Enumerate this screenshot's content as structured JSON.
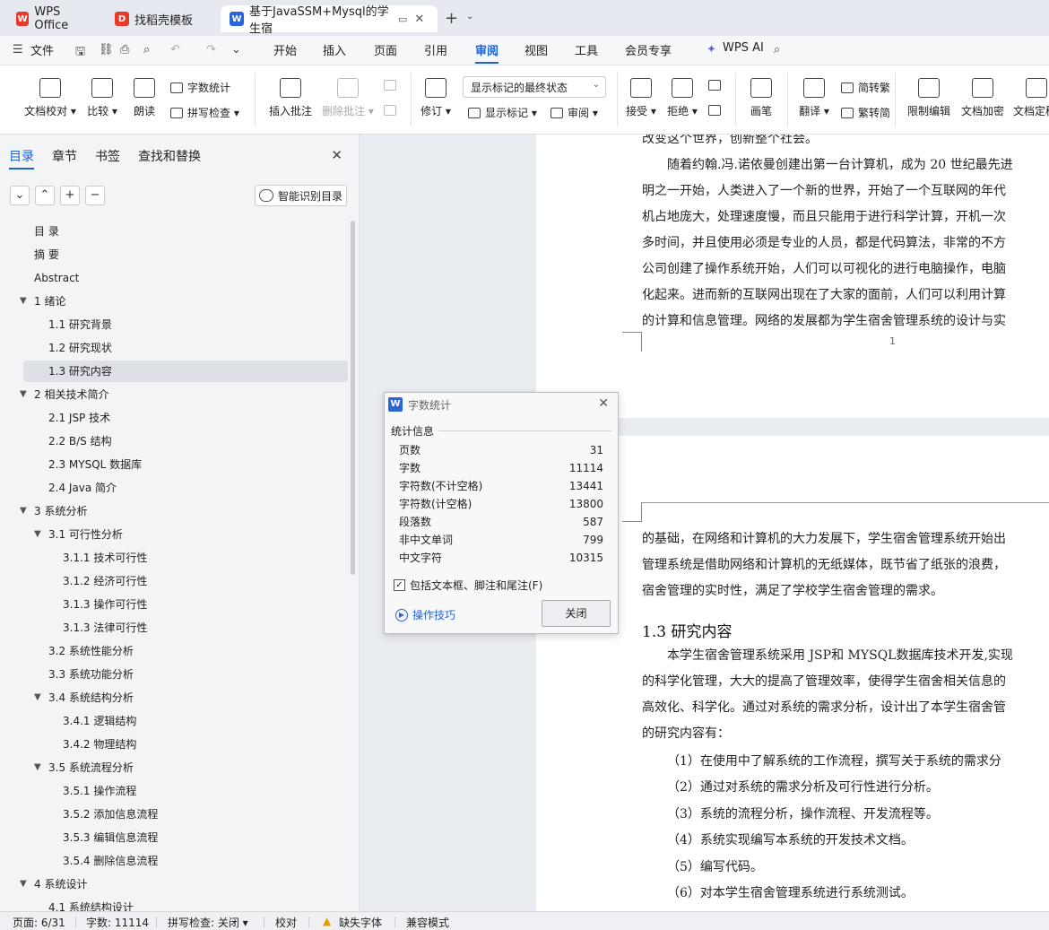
{
  "tabs": [
    {
      "label": "WPS Office",
      "icon": "wps-logo-icon",
      "color": "#e8392b"
    },
    {
      "label": "找稻壳模板",
      "icon": "docer-icon",
      "color": "#e8392b"
    },
    {
      "label": "基于JavaSSM+Mysql的学生宿",
      "icon": "writer-icon",
      "color": "#2b63d9"
    }
  ],
  "menu": {
    "file": "文件",
    "items": [
      "开始",
      "插入",
      "页面",
      "引用",
      "审阅",
      "视图",
      "工具",
      "会员专享"
    ],
    "active": "审阅",
    "wps_ai": "WPS AI"
  },
  "ribbon": {
    "doc_check": "文档校对",
    "compare": "比较",
    "read_aloud": "朗读",
    "word_count": "字数统计",
    "spell_check": "拼写检查",
    "insert_comment": "插入批注",
    "delete_comment": "删除批注",
    "revise": "修订",
    "show_mode": "显示标记的最终状态",
    "show_marks": "显示标记",
    "review_pane": "审阅",
    "accept": "接受",
    "reject": "拒绝",
    "pen": "画笔",
    "translate": "翻译",
    "to_traditional": "简转繁",
    "to_simplified": "繁转简",
    "restrict_edit": "限制编辑",
    "doc_encrypt": "文档加密",
    "doc_finalize": "文档定稿"
  },
  "sidebar": {
    "tabs": [
      "目录",
      "章节",
      "书签",
      "查找和替换"
    ],
    "smart_toc": "智能识别目录",
    "toc": [
      {
        "label": "目  录",
        "level": 1
      },
      {
        "label": "摘    要",
        "level": 1
      },
      {
        "label": "Abstract",
        "level": 1
      },
      {
        "label": "1  绪论",
        "level": 1,
        "toggle": "▼"
      },
      {
        "label": "1.1 研究背景",
        "level": 2
      },
      {
        "label": "1.2 研究现状",
        "level": 2
      },
      {
        "label": "1.3 研究内容",
        "level": 2,
        "highlight": true
      },
      {
        "label": "2  相关技术简介",
        "level": 1,
        "toggle": "▼"
      },
      {
        "label": "2.1 JSP 技术",
        "level": 2
      },
      {
        "label": "2.2 B/S 结构",
        "level": 2
      },
      {
        "label": "2.3 MYSQL 数据库",
        "level": 2
      },
      {
        "label": "2.4 Java 简介",
        "level": 2
      },
      {
        "label": "3   系统分析",
        "level": 1,
        "toggle": "▼"
      },
      {
        "label": "3.1  可行性分析",
        "level": 2,
        "toggle": "▼"
      },
      {
        "label": "3.1.1  技术可行性",
        "level": 3
      },
      {
        "label": "3.1.2  经济可行性",
        "level": 3
      },
      {
        "label": "3.1.3  操作可行性",
        "level": 3
      },
      {
        "label": "3.1.3  法律可行性",
        "level": 3
      },
      {
        "label": "3.2  系统性能分析",
        "level": 2
      },
      {
        "label": "3.3  系统功能分析",
        "level": 2
      },
      {
        "label": "3.4  系统结构分析",
        "level": 2,
        "toggle": "▼"
      },
      {
        "label": "3.4.1  逻辑结构",
        "level": 3
      },
      {
        "label": "3.4.2  物理结构",
        "level": 3
      },
      {
        "label": "3.5  系统流程分析",
        "level": 2,
        "toggle": "▼"
      },
      {
        "label": "3.5.1  操作流程",
        "level": 3
      },
      {
        "label": "3.5.2  添加信息流程",
        "level": 3
      },
      {
        "label": "3.5.3  编辑信息流程",
        "level": 3
      },
      {
        "label": "3.5.4  删除信息流程",
        "level": 3
      },
      {
        "label": "4  系统设计",
        "level": 1,
        "toggle": "▼"
      },
      {
        "label": "4.1  系统结构设计",
        "level": 2
      }
    ]
  },
  "document": {
    "page1_lines": [
      "改变这个世界，创新整个社会。",
      "随着约翰.冯.诺依曼创建出第一台计算机，成为 20 世纪最先进",
      "明之一开始，人类进入了一个新的世界，开始了一个互联网的年代",
      "机占地庞大，处理速度慢，而且只能用于进行科学计算，开机一次",
      "多时间，并且使用必须是专业的人员，都是代码算法，非常的不方",
      "公司创建了操作系统开始，人们可以可视化的进行电脑操作，电脑",
      "化起来。进而新的互联网出现在了大家的面前，人们可以利用计算",
      "的计算和信息管理。网络的发展都为学生宿舍管理系统的设计与实"
    ],
    "page_number": "1",
    "page2_lines": [
      "的基础，在网络和计算机的大力发展下，学生宿舍管理系统开始出",
      "管理系统是借助网络和计算机的无纸媒体，既节省了纸张的浪费，",
      "宿舍管理的实时性，满足了学校学生宿舍管理的需求。"
    ],
    "heading": "1.3 研究内容",
    "page2_body": [
      "本学生宿舍管理系统采用 JSP和 MYSQL数据库技术开发,实现",
      "的科学化管理，大大的提高了管理效率，使得学生宿舍相关信息的",
      "高效化、科学化。通过对系统的需求分析，设计出了本学生宿舍管",
      "的研究内容有："
    ],
    "list_items": [
      "（1）在使用中了解系统的工作流程，撰写关于系统的需求分",
      "（2）通过对系统的需求分析及可行性进行分析。",
      "（3）系统的流程分析，操作流程、开发流程等。",
      "（4）系统实现编写本系统的开发技术文档。",
      "（5）编写代码。",
      "（6）对本学生宿舍管理系统进行系统测试。"
    ]
  },
  "dialog": {
    "title": "字数统计",
    "group": "统计信息",
    "stats": [
      {
        "label": "页数",
        "value": "31"
      },
      {
        "label": "字数",
        "value": "11114"
      },
      {
        "label": "字符数(不计空格)",
        "value": "13441"
      },
      {
        "label": "字符数(计空格)",
        "value": "13800"
      },
      {
        "label": "段落数",
        "value": "587"
      },
      {
        "label": "非中文单词",
        "value": "799"
      },
      {
        "label": "中文字符",
        "value": "10315"
      }
    ],
    "checkbox_label": "包括文本框、脚注和尾注(F)",
    "checkbox_checked": true,
    "tips": "操作技巧",
    "close": "关闭"
  },
  "status": {
    "page": "页面: 6/31",
    "words": "字数: 11114",
    "spell": "拼写检查: 关闭",
    "proof": "校对",
    "missing_font": "缺失字体",
    "compat": "兼容模式"
  }
}
